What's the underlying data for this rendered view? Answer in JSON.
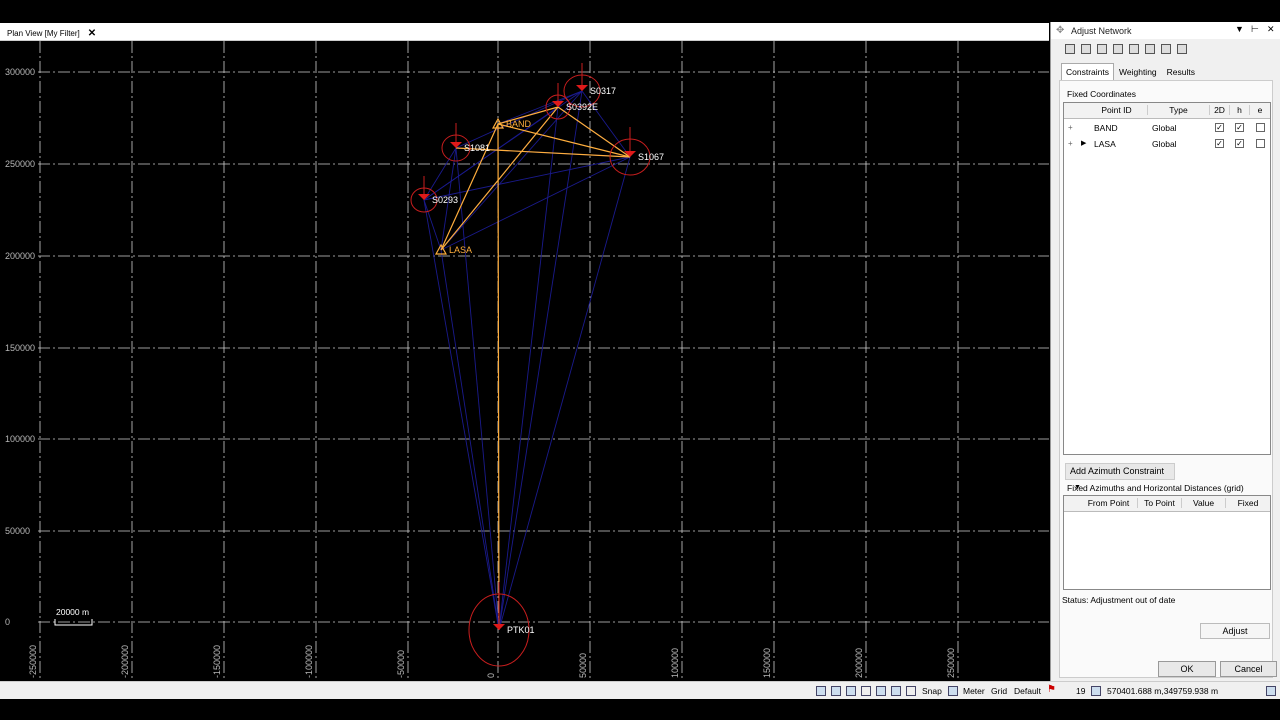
{
  "view_tab": {
    "label": "Plan View [My Filter]",
    "close": "✕"
  },
  "plan": {
    "y_labels": [
      "300000",
      "250000",
      "200000",
      "150000",
      "100000",
      "50000",
      "0"
    ],
    "x_labels": [
      "-250000",
      "-200000",
      "-150000",
      "-100000",
      "-50000",
      "0",
      "50000",
      "100000",
      "150000",
      "200000",
      "250000"
    ],
    "scale_label": "20000 m",
    "points": [
      {
        "id": "S0317",
        "kind": "point"
      },
      {
        "id": "S0392E",
        "kind": "point"
      },
      {
        "id": "BAND",
        "kind": "control"
      },
      {
        "id": "S1081",
        "kind": "point"
      },
      {
        "id": "S1067",
        "kind": "point"
      },
      {
        "id": "S0293",
        "kind": "point"
      },
      {
        "id": "LASA",
        "kind": "control"
      },
      {
        "id": "PTK01",
        "kind": "point"
      }
    ],
    "colors": {
      "grid": "#cfcfcf",
      "obs": "#1a1a8c",
      "control_line": "#ffae3d",
      "ellipse": "#c81e1e",
      "label": "#ffffff",
      "control_label": "#ffae3d"
    }
  },
  "panel": {
    "title": "Adjust Network",
    "ctrl_dropdown": "▼",
    "ctrl_pin": "⊢",
    "ctrl_close": "✕",
    "tabs": [
      "Constraints",
      "Weighting",
      "Results"
    ],
    "fixed_coords_label": "Fixed Coordinates",
    "coord_columns": [
      "Point ID",
      "Type",
      "2D",
      "h",
      "e"
    ],
    "coord_rows": [
      {
        "expand": "+",
        "id": "BAND",
        "type": "Global",
        "d2": "✓",
        "h": "✓",
        "e": ""
      },
      {
        "expand": "+",
        "id": "LASA",
        "type": "Global",
        "d2": "✓",
        "h": "✓",
        "e": ""
      }
    ],
    "add_azimuth": "Add Azimuth Constraint",
    "fixed_az_label": "Fixed Azimuths and Horizontal Distances (grid)",
    "az_columns": [
      "From Point",
      "To Point",
      "Value",
      "Fixed"
    ],
    "status": "Status: Adjustment out of date",
    "adjust": "Adjust",
    "ok": "OK",
    "cancel": "Cancel"
  },
  "statusbar": {
    "snap": "Snap",
    "meter": "Meter",
    "grid": "Grid",
    "default": "Default",
    "count": "19",
    "coords": "570401.688 m,349759.938 m"
  }
}
